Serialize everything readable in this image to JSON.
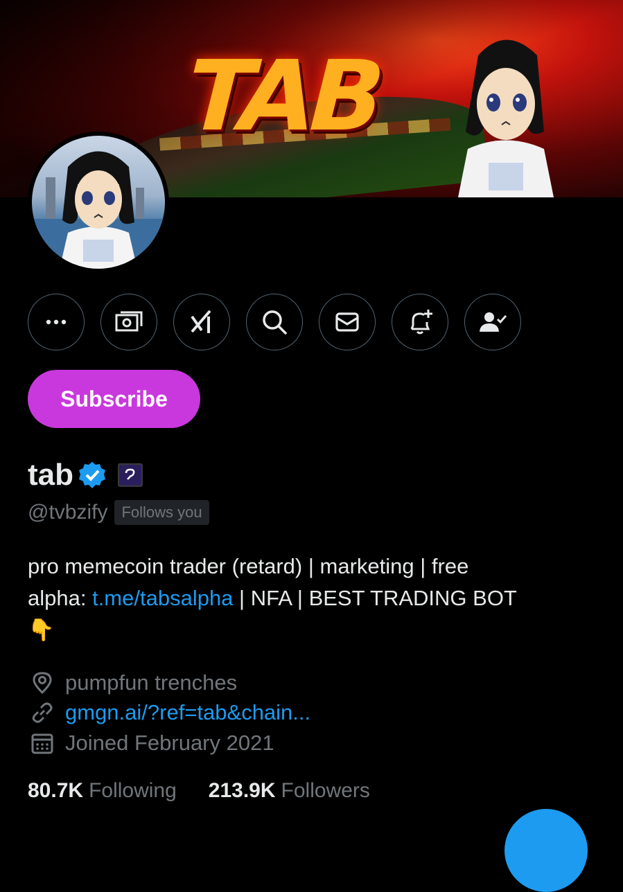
{
  "banner": {
    "logo_text": "TAB"
  },
  "actions": [
    {
      "name": "more-button",
      "icon": "more-dots-icon"
    },
    {
      "name": "money-button",
      "icon": "money-icon"
    },
    {
      "name": "grok-button",
      "icon": "grok-icon"
    },
    {
      "name": "search-button",
      "icon": "search-icon"
    },
    {
      "name": "message-button",
      "icon": "mail-icon"
    },
    {
      "name": "notifications-button",
      "icon": "bell-plus-icon"
    },
    {
      "name": "following-button",
      "icon": "person-check-icon"
    }
  ],
  "subscribe_label": "Subscribe",
  "profile": {
    "display_name": "tab",
    "handle": "@tvbzify",
    "follows_you": "Follows you",
    "bio": {
      "line1": "pro memecoin trader (retard) | marketing | free",
      "prefix": "alpha: ",
      "link": "t.me/tabsalpha",
      "suffix": " | NFA | BEST TRADING BOT",
      "emoji": "👇"
    },
    "location": "pumpfun trenches",
    "website": "gmgn.ai/?ref=tab&chain...",
    "joined": "Joined February 2021",
    "following_count": "80.7K",
    "following_label": "Following",
    "followers_count": "213.9K",
    "followers_label": "Followers"
  },
  "colors": {
    "accent": "#1d9bf0",
    "subscribe": "#c938dd",
    "muted": "#71767b"
  }
}
